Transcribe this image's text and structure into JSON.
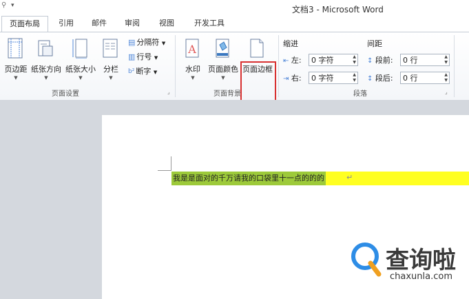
{
  "window": {
    "title": "文档3 - Microsoft Word"
  },
  "tabs": [
    "页面布局",
    "引用",
    "邮件",
    "审阅",
    "视图",
    "开发工具"
  ],
  "active_tab": "页面布局",
  "ribbon": {
    "page_setup": {
      "label": "页面设置",
      "margins": "页边距",
      "orientation": "纸张方向",
      "size": "纸张大小",
      "columns": "分栏",
      "breaks": "分隔符",
      "line_numbers": "行号",
      "hyphenation": "断字"
    },
    "page_background": {
      "label": "页面背景",
      "watermark": "水印",
      "page_color": "页面颜色",
      "page_borders": "页面边框"
    },
    "paragraph": {
      "label": "段落",
      "indent_heading": "缩进",
      "spacing_heading": "间距",
      "left_label": "左:",
      "left_value": "0 字符",
      "right_label": "右:",
      "right_value": "0 字符",
      "before_label": "段前:",
      "before_value": "0 行",
      "after_label": "段后:",
      "after_value": "0 行"
    }
  },
  "document": {
    "text": "我是是面对的千万请我的口袋里十一点的的的",
    "paragraph_mark": "↵"
  },
  "watermark": {
    "name": "查询啦",
    "domain": "chaxunla.com"
  },
  "colors": {
    "highlight": "#ffff22",
    "selection": "#9dca3a",
    "red_box": "#d83030",
    "accent": "#2e8de6"
  }
}
